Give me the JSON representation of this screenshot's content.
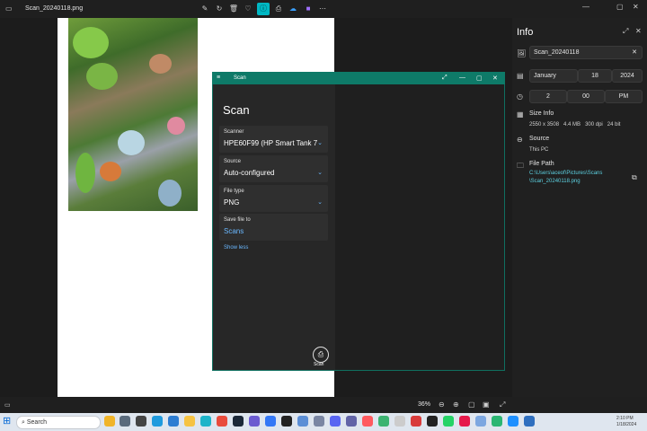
{
  "app": {
    "title": "Scan_20240118.png",
    "toolbar_icons": [
      "edit-icon",
      "rotate-icon",
      "delete-icon",
      "favorite-icon",
      "info-icon",
      "print-icon",
      "onedrive-icon",
      "clipchamp-icon",
      "more-icon"
    ],
    "window_controls": [
      "minimize-icon",
      "maximize-icon",
      "close-icon"
    ]
  },
  "info_panel": {
    "title": "Info",
    "filename": "Scan_20240118",
    "date": {
      "month": "January",
      "day": "18",
      "year": "2024"
    },
    "time": {
      "hour": "2",
      "minute": "00",
      "ampm": "PM"
    },
    "size_info_label": "Size Info",
    "size_info": {
      "dimensions": "2550 x 3508",
      "size": "4.4 MB",
      "dpi": "300 dpi",
      "bits": "24 bit"
    },
    "source_label": "Source",
    "source_value": "This PC",
    "path_label": "File Path",
    "path_line1": "C:\\Users\\aceof\\Pictures\\Scans",
    "path_line2": "\\Scan_20240118.png"
  },
  "scan": {
    "window_title": "Scan",
    "heading": "Scan",
    "scanner_label": "Scanner",
    "scanner_value": "HPE60F99 (HP Smart Tank 7",
    "source_label": "Source",
    "source_value": "Auto-configured",
    "filetype_label": "File type",
    "filetype_value": "PNG",
    "savefile_label": "Save file to",
    "savefile_value": "Scans",
    "show_less": "Show less",
    "scan_button": "Scan"
  },
  "statusbar": {
    "zoom": "36%"
  },
  "taskbar": {
    "search_placeholder": "Search",
    "time": "2:10 PM",
    "date": "1/18/2024"
  },
  "colors": {
    "accent": "#00b7c3",
    "scan_titlebar": "#0e7a68",
    "link": "#5cd0e0",
    "dropdown_chevron": "#6ab8ff"
  }
}
